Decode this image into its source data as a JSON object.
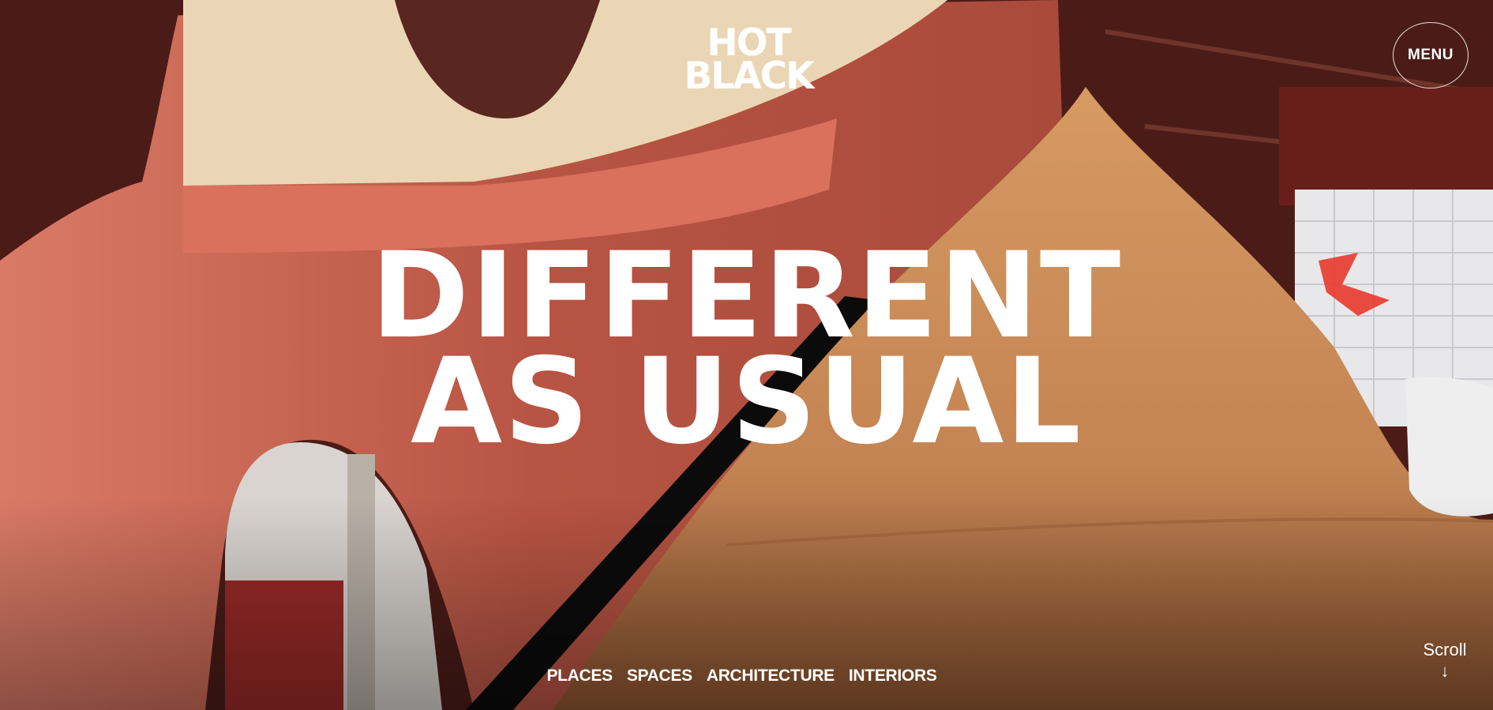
{
  "brand": {
    "logo_line1": "HOT",
    "logo_line2": "BLACK"
  },
  "header": {
    "menu_label": "MENU"
  },
  "hero": {
    "headline_line1": "DIFFERENT",
    "headline_line2": "AS USUAL"
  },
  "nav": {
    "items": [
      "PLACES",
      "SPACES",
      "ARCHITECTURE",
      "INTERIORS"
    ]
  },
  "scroll": {
    "label": "Scroll",
    "arrow": "↓"
  },
  "colors": {
    "terracotta": "#c8604c",
    "wood": "#e9d4b3",
    "leather": "#c98955",
    "ceiling": "#4e1d18"
  }
}
